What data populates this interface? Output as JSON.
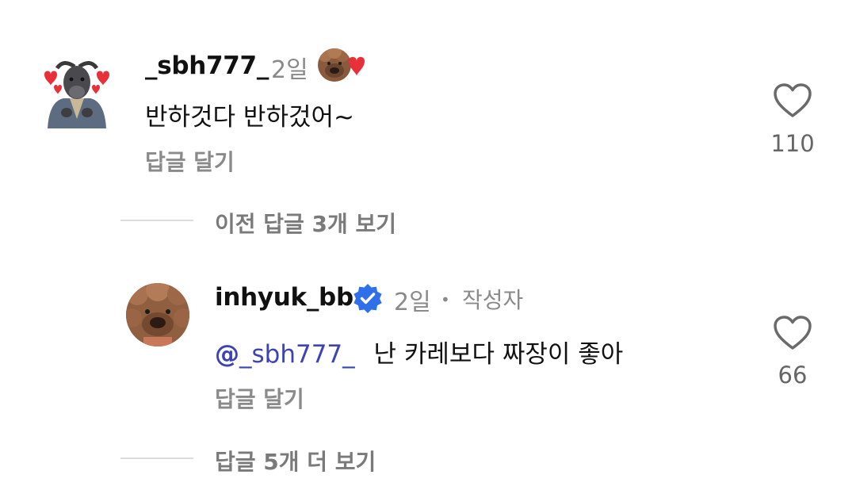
{
  "comments": [
    {
      "username": "_sbh777_",
      "time": "2일",
      "text": "반하것다 반하겄어~",
      "reply_label": "답글 달기",
      "likes": "110",
      "avatar_icon": "buffalo-with-hearts-avatar",
      "liked_by_icon": "author-avatar-with-heart-icon"
    },
    {
      "username": "inhyuk_bb",
      "verified_icon": "verified-badge-icon",
      "time": "2일",
      "author_label": "작성자",
      "mention": "_sbh777_",
      "text": "난 카레보다 짜장이 좋아",
      "reply_label": "답글 달기",
      "likes": "66",
      "avatar_icon": "dog-avatar"
    }
  ],
  "thread": {
    "previous_replies": "이전 답글 3개 보기",
    "more_replies": "답글 5개 더 보기"
  },
  "colors": {
    "mention": "#3c44b4",
    "verified": "#2f6fea",
    "heart_red": "#e8303a",
    "muted": "#8a8a8a"
  }
}
